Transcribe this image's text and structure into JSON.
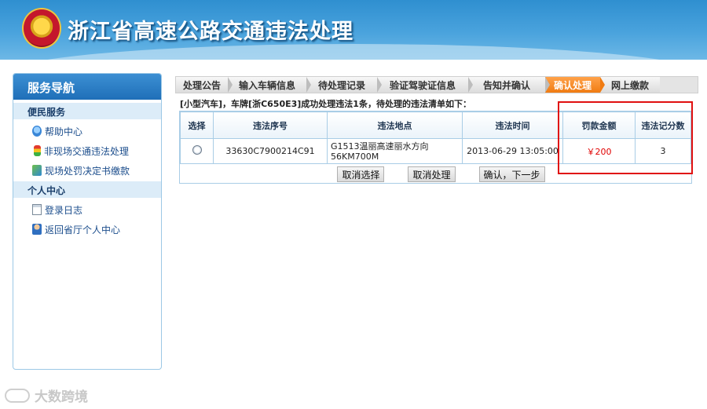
{
  "header": {
    "title": "浙江省高速公路交通违法处理"
  },
  "sidebar": {
    "title": "服务导航",
    "sections": [
      {
        "label": "便民服务",
        "items": [
          {
            "label": "帮助中心",
            "icon": "help-icon"
          },
          {
            "label": "非现场交通违法处理",
            "icon": "traffic-light-icon"
          },
          {
            "label": "现场处罚决定书缴款",
            "icon": "payment-icon"
          }
        ]
      },
      {
        "label": "个人中心",
        "items": [
          {
            "label": "登录日志",
            "icon": "notepad-icon"
          },
          {
            "label": "返回省厅个人中心",
            "icon": "user-icon"
          }
        ]
      }
    ]
  },
  "steps": [
    {
      "label": "处理公告",
      "active": false
    },
    {
      "label": "输入车辆信息",
      "active": false
    },
    {
      "label": "待处理记录",
      "active": false
    },
    {
      "label": "验证驾驶证信息",
      "active": false
    },
    {
      "label": "告知并确认",
      "active": false
    },
    {
      "label": "确认处理",
      "active": true
    },
    {
      "label": "网上缴款",
      "active": false
    }
  ],
  "notice": "[小型汽车]，车牌[浙C650E3]成功处理违法1条，待处理的违法清单如下：",
  "table": {
    "headers": [
      "选择",
      "违法序号",
      "违法地点",
      "违法时间",
      "罚款金额",
      "违法记分数"
    ],
    "rows": [
      {
        "id": "33630C7900214C91",
        "location": "G1513温丽高速丽水方向56KM700M",
        "time": "2013-06-29 13:05:00",
        "fine": "￥200",
        "points": "3"
      }
    ]
  },
  "buttons": {
    "cancel_select": "取消选择",
    "cancel_process": "取消处理",
    "confirm_next": "确认，下一步"
  },
  "watermark": "大数跨境",
  "colors": {
    "active_step": "#f07b12",
    "highlight": "#e01010",
    "fine": "#e00000"
  }
}
